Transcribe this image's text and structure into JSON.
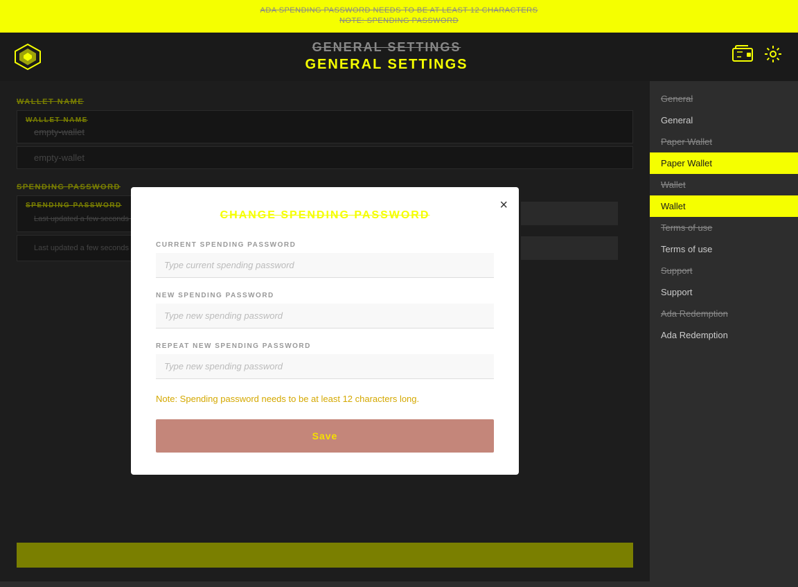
{
  "topBanner": {
    "line1": "ADA SPENDING PASSWORD NEEDS TO BE AT LEAST 12 CHARACTERS",
    "line2": "NOTE: SPENDING PASSWORD"
  },
  "header": {
    "title1": "GENERAL SETTINGS",
    "title2": "GENERAL SETTINGS",
    "walletIconAlt": "wallet-icon",
    "settingsIconAlt": "settings-icon"
  },
  "sidebar": {
    "items": [
      {
        "label": "General",
        "state": "strikethrough"
      },
      {
        "label": "General",
        "state": "normal"
      },
      {
        "label": "Paper Wallet",
        "state": "strikethrough"
      },
      {
        "label": "Paper Wallet",
        "state": "active"
      },
      {
        "label": "Wallet",
        "state": "strikethrough"
      },
      {
        "label": "Wallet",
        "state": "active"
      },
      {
        "label": "Terms of use",
        "state": "strikethrough"
      },
      {
        "label": "Terms of use",
        "state": "normal"
      },
      {
        "label": "Support",
        "state": "strikethrough"
      },
      {
        "label": "Support",
        "state": "normal"
      },
      {
        "label": "Ada Redemption",
        "state": "strikethrough"
      },
      {
        "label": "Ada Redemption",
        "state": "normal"
      }
    ]
  },
  "content": {
    "walletNameLabel": "WALLET NAME",
    "walletNameFieldLabel": "WALLET NAME",
    "walletNameValue": "empty-wallet",
    "walletNameValue2": "empty-wallet",
    "spendingPasswordLabel": "SPENDING PASSWORD",
    "spendingPasswordFieldLabel": "SPENDING PASSWORD",
    "lastUpdated1": "Last updated a few seconds ago",
    "lastUpdated2": "Last updated a few seconds ago"
  },
  "modal": {
    "title": "CHANGE SPENDING PASSWORD",
    "currentPasswordLabel": "CURRENT SPENDING PASSWORD",
    "currentPasswordPlaceholder": "Type current spending password",
    "newPasswordLabel": "NEW SPENDING PASSWORD",
    "newPasswordPlaceholder": "Type new spending password",
    "repeatPasswordLabel": "REPEAT NEW SPENDING PASSWORD",
    "repeatPasswordPlaceholder": "Type new spending password",
    "note": "Note: Spending password needs to be at least 12 characters long.",
    "saveLabel": "Save",
    "closeLabel": "×"
  }
}
